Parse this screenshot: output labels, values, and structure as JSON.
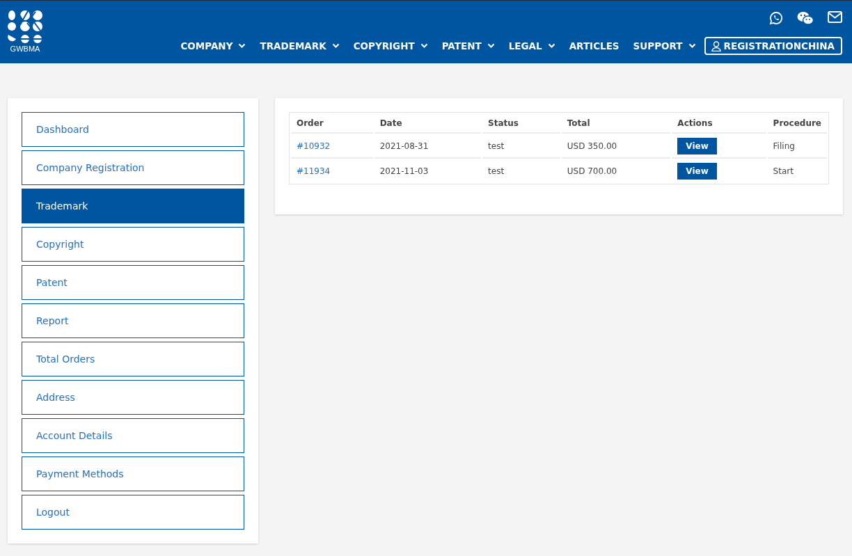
{
  "header": {
    "logo_text": "GWBMA",
    "nav": [
      {
        "label": "COMPANY",
        "dropdown": true
      },
      {
        "label": "TRADEMARK",
        "dropdown": true
      },
      {
        "label": "COPYRIGHT",
        "dropdown": true
      },
      {
        "label": "PATENT",
        "dropdown": true
      },
      {
        "label": "LEGAL",
        "dropdown": true
      },
      {
        "label": "ARTICLES",
        "dropdown": false
      },
      {
        "label": "SUPPORT",
        "dropdown": true
      }
    ],
    "account_button": "REGISTRATIONCHINA"
  },
  "sidebar": {
    "items": [
      {
        "label": "Dashboard",
        "selected": false
      },
      {
        "label": "Company Registration",
        "selected": false
      },
      {
        "label": "Trademark",
        "selected": true
      },
      {
        "label": "Copyright",
        "selected": false
      },
      {
        "label": "Patent",
        "selected": false
      },
      {
        "label": "Report",
        "selected": false
      },
      {
        "label": "Total Orders",
        "selected": false
      },
      {
        "label": "Address",
        "selected": false
      },
      {
        "label": "Account Details",
        "selected": false
      },
      {
        "label": "Payment Methods",
        "selected": false
      },
      {
        "label": "Logout",
        "selected": false
      }
    ]
  },
  "orders": {
    "columns": [
      "Order",
      "Date",
      "Status",
      "Total",
      "Actions",
      "Procedure"
    ],
    "rows": [
      {
        "order": "#10932",
        "date": "2021-08-31",
        "status": "test",
        "total": "USD 350.00",
        "action": "View",
        "procedure": "Filing"
      },
      {
        "order": "#11934",
        "date": "2021-11-03",
        "status": "test",
        "total": "USD 700.00",
        "action": "View",
        "procedure": "Start"
      }
    ]
  }
}
